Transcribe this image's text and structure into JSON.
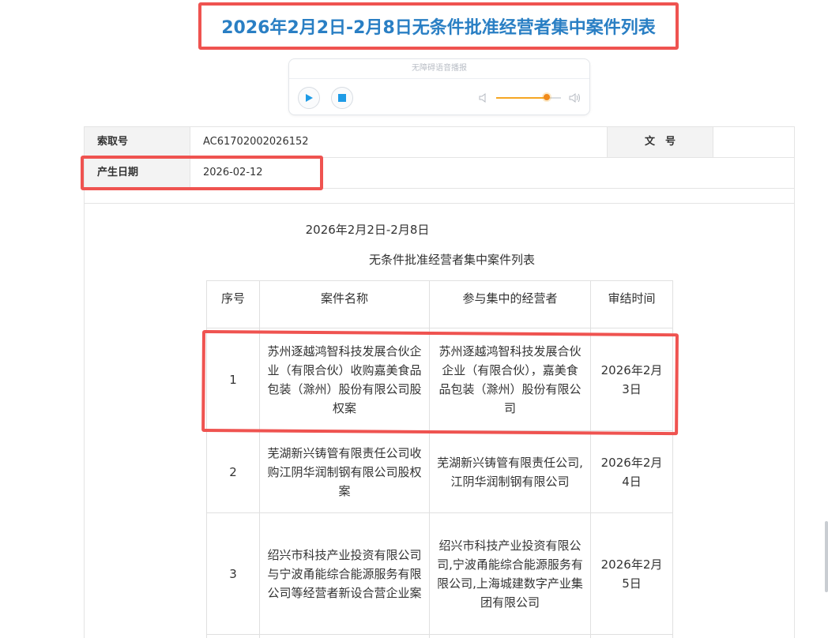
{
  "page": {
    "title": "2026年2月2日-2月8日无条件批准经营者集中案件列表"
  },
  "player": {
    "label": "无障碍语音播报",
    "volume_percent": 78
  },
  "meta": {
    "index_label": "索取号",
    "index_value": "AC61702002026152",
    "doc_no_label": "文　号",
    "doc_no_value": "",
    "date_label": "产生日期",
    "date_value": "2026-02-12"
  },
  "document": {
    "date_range": "2026年2月2日-2月8日",
    "subtitle": "无条件批准经营者集中案件列表",
    "table": {
      "headers": [
        "序号",
        "案件名称",
        "参与集中的经营者",
        "审结时间"
      ],
      "rows": [
        {
          "no": "1",
          "case_name": "苏州逐越鸿智科技发展合伙企业（有限合伙）收购嘉美食品包装（滁州）股份有限公司股权案",
          "parties": "苏州逐越鸿智科技发展合伙企业（有限合伙），嘉美食品包装（滁州）股份有限公司",
          "date": "2026年2月3日"
        },
        {
          "no": "2",
          "case_name": "芜湖新兴铸管有限责任公司收购江阴华润制钢有限公司股权案",
          "parties": "芜湖新兴铸管有限责任公司,江阴华润制钢有限公司",
          "date": "2026年2月4日"
        },
        {
          "no": "3",
          "case_name": "绍兴市科技产业投资有限公司与宁波甬能综合能源服务有限公司等经营者新设合营企业案",
          "parties": "绍兴市科技产业投资有限公司,宁波甬能综合能源服务有限公司,上海城建数字产业集团有限公司",
          "date": "2026年2月5日"
        }
      ]
    }
  },
  "colors": {
    "title": "#2a7fc4",
    "highlight": "#ef5350",
    "slider": "#f5a623"
  },
  "icons": {
    "play": "play-icon",
    "stop": "stop-icon",
    "volume_low": "volume-low-icon",
    "volume_high": "volume-high-icon"
  }
}
